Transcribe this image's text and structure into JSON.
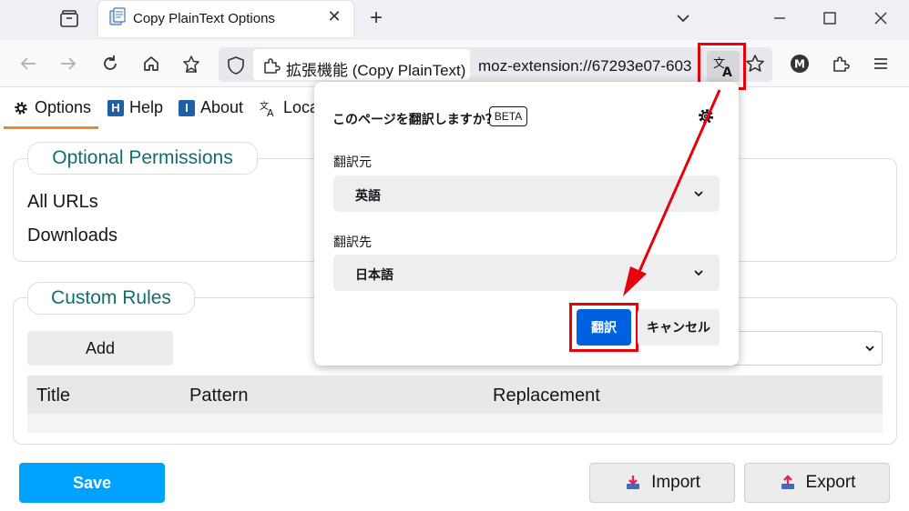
{
  "browser": {
    "tab_title": "Copy PlainText Options",
    "url_identity": "拡張機能 (Copy PlainText)",
    "url_text": "moz-extension://67293e07-603",
    "accent_red": "#e8000b"
  },
  "ext_tabs": [
    {
      "label": "Options",
      "icon": "gear-icon"
    },
    {
      "label": "Help",
      "icon": "help-badge-icon",
      "badge": "H"
    },
    {
      "label": "About",
      "icon": "info-badge-icon",
      "badge": "I"
    },
    {
      "label": "Loca",
      "icon": "translate-icon"
    }
  ],
  "optional_permissions": {
    "legend": "Optional Permissions",
    "items": [
      "All URLs",
      "Downloads"
    ]
  },
  "custom_rules": {
    "legend": "Custom Rules",
    "add_label": "Add",
    "columns": [
      "Title",
      "Pattern",
      "Replacement"
    ]
  },
  "footer": {
    "save_label": "Save",
    "import_label": "Import",
    "export_label": "Export",
    "save_color": "#00a2ff"
  },
  "popup": {
    "title": "このページを翻訳しますか？",
    "beta": "BETA",
    "from_label": "翻訳元",
    "from_value": "英語",
    "to_label": "翻訳先",
    "to_value": "日本語",
    "translate_label": "翻訳",
    "cancel_label": "キャンセル",
    "translate_color": "#0061e0"
  }
}
